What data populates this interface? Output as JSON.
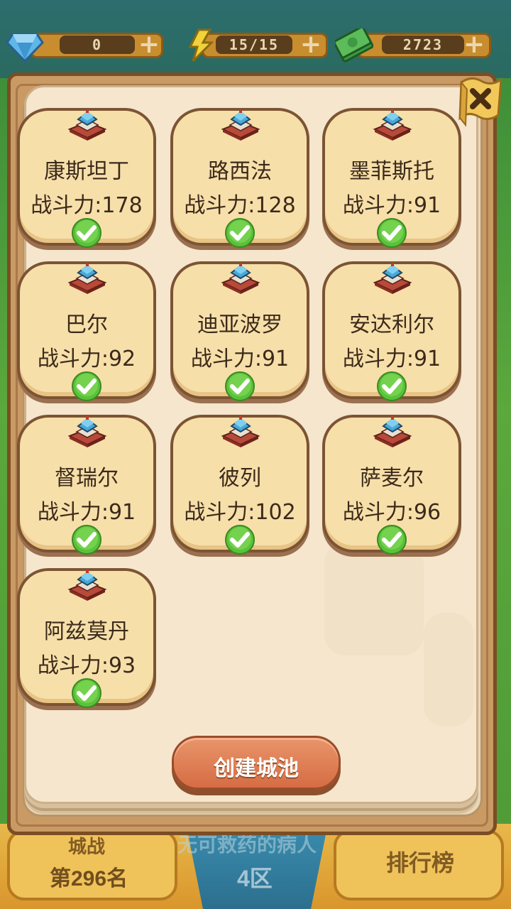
{
  "resources": {
    "gems": {
      "icon": "diamond-icon",
      "value": "0"
    },
    "energy": {
      "icon": "lightning-icon",
      "value": "15/15"
    },
    "money": {
      "icon": "cash-icon",
      "value": "2723"
    }
  },
  "background": {
    "city_war_label": "城战",
    "rank_label": "第296名",
    "notice_text": "无可救药的病人",
    "zone_label": "4区",
    "leaderboard_label": "排行榜"
  },
  "cities": [
    {
      "name": "康斯坦丁",
      "power": "战斗力:178",
      "selected": true
    },
    {
      "name": "路西法",
      "power": "战斗力:128",
      "selected": true
    },
    {
      "name": "墨菲斯托",
      "power": "战斗力:91",
      "selected": true
    },
    {
      "name": "巴尔",
      "power": "战斗力:92",
      "selected": true
    },
    {
      "name": "迪亚波罗",
      "power": "战斗力:91",
      "selected": true
    },
    {
      "name": "安达利尔",
      "power": "战斗力:91",
      "selected": true
    },
    {
      "name": "督瑞尔",
      "power": "战斗力:91",
      "selected": true
    },
    {
      "name": "彼列",
      "power": "战斗力:102",
      "selected": true
    },
    {
      "name": "萨麦尔",
      "power": "战斗力:96",
      "selected": true
    },
    {
      "name": "阿兹莫丹",
      "power": "战斗力:93",
      "selected": true
    }
  ],
  "create_button": {
    "label": "创建城池"
  },
  "colors": {
    "card_fill": "#f7dfaa",
    "card_border": "#7c5433",
    "check_green": "#5ac23a",
    "button_orange": "#d66c44"
  }
}
